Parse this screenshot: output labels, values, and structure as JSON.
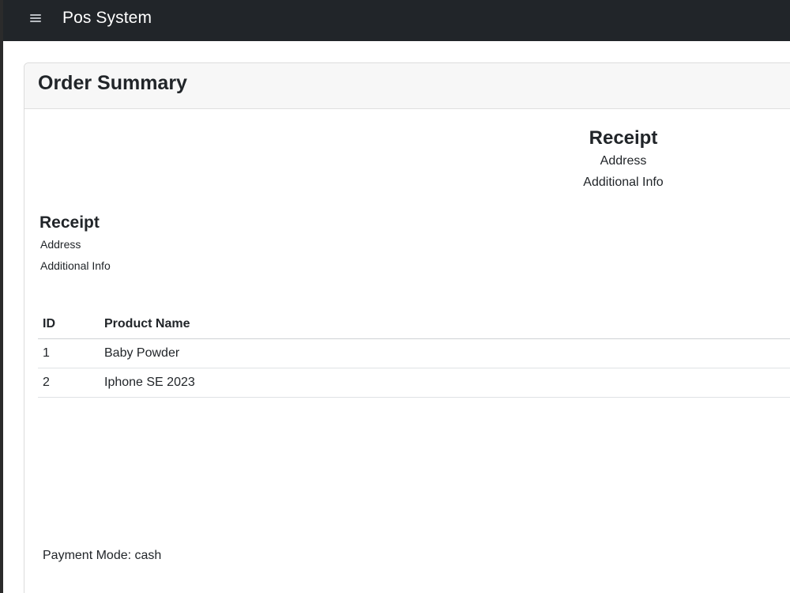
{
  "navbar": {
    "brand": "Pos System"
  },
  "card": {
    "title": "Order Summary"
  },
  "receipt_center": {
    "title": "Receipt",
    "address": "Address",
    "additional_info": "Additional Info"
  },
  "receipt_left": {
    "title": "Receipt",
    "address": "Address",
    "additional_info": "Additional Info"
  },
  "table": {
    "headers": [
      "ID",
      "Product Name"
    ],
    "rows": [
      {
        "id": "1",
        "name": "Baby Powder"
      },
      {
        "id": "2",
        "name": "Iphone SE 2023"
      }
    ]
  },
  "payment": {
    "text": "Payment Mode: cash"
  },
  "colors": {
    "navbar": "#212529",
    "header_bg": "#f7f7f7"
  },
  "icons": {
    "menu": "hamburger-icon"
  }
}
